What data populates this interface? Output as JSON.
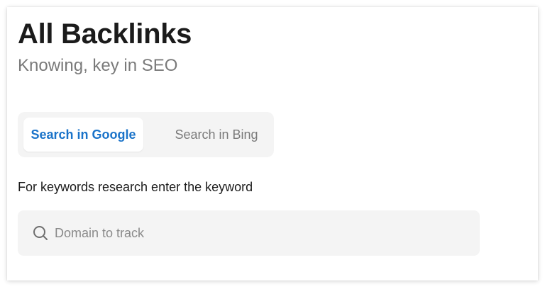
{
  "header": {
    "title": "All Backlinks",
    "subtitle": "Knowing, key in SEO"
  },
  "tabs": [
    {
      "label": "Search in Google",
      "active": true
    },
    {
      "label": "Search in Bing",
      "active": false
    }
  ],
  "prompt": "For keywords research enter the keyword",
  "search": {
    "placeholder": "Domain to track",
    "value": "",
    "icon": "search-icon"
  },
  "colors": {
    "accent": "#1a73c9",
    "title": "#1b1b1b",
    "muted": "#7a7a7a",
    "field_bg": "#f4f4f4"
  }
}
